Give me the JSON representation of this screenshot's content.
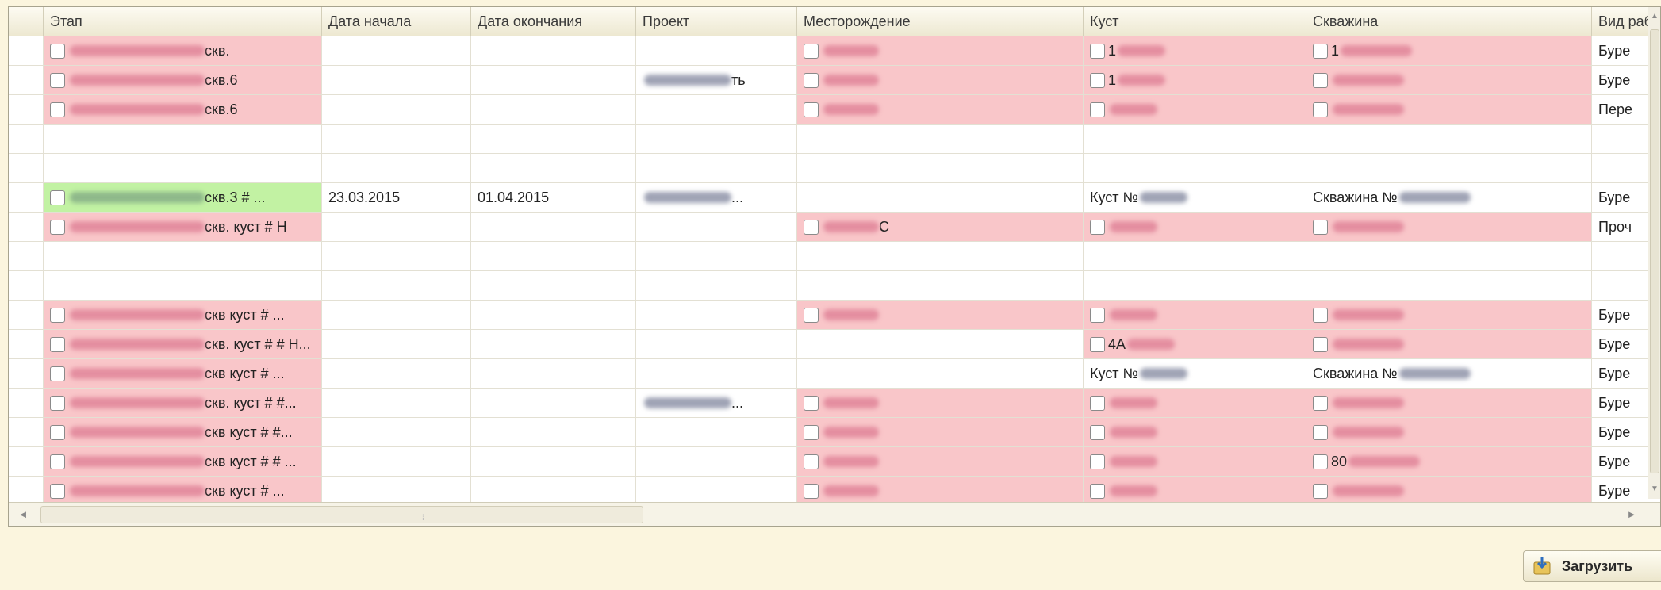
{
  "columns": [
    {
      "key": "stage",
      "label": "Этап"
    },
    {
      "key": "start",
      "label": "Дата начала"
    },
    {
      "key": "end",
      "label": "Дата окончания"
    },
    {
      "key": "project",
      "label": "Проект"
    },
    {
      "key": "field",
      "label": "Месторождение"
    },
    {
      "key": "pad",
      "label": "Куст"
    },
    {
      "key": "well",
      "label": "Скважина"
    },
    {
      "key": "work",
      "label": "Вид раб"
    }
  ],
  "rows": [
    {
      "stage": "скв.",
      "start": "",
      "end": "",
      "project": "",
      "field": "",
      "pad": "1",
      "well": "1",
      "work": "Буре"
    },
    {
      "stage": "скв.6",
      "start": "",
      "end": "",
      "project": "ть",
      "field": "",
      "pad": "1",
      "well": "",
      "work": "Буре"
    },
    {
      "stage": "скв.6",
      "start": "",
      "end": "",
      "project": "",
      "field": "",
      "pad": "",
      "well": "",
      "work": "Пере"
    },
    {
      "stage": "",
      "start": "",
      "end": "",
      "project": "",
      "field": "",
      "pad": "",
      "well": "",
      "work": ""
    },
    {
      "stage": "",
      "start": "",
      "end": "",
      "project": "",
      "field": "",
      "pad": "",
      "well": "",
      "work": ""
    },
    {
      "stage": "скв.3 # ...",
      "start": "23.03.2015",
      "end": "01.04.2015",
      "project": "...",
      "field": "",
      "pad": "Куст №",
      "well": "Скважина №",
      "work": "Буре"
    },
    {
      "stage": "скв. куст # Н",
      "start": "",
      "end": "",
      "project": "",
      "field": "С",
      "pad": "",
      "well": "",
      "work": "Проч"
    },
    {
      "stage": "",
      "start": "",
      "end": "",
      "project": "",
      "field": "",
      "pad": "",
      "well": "",
      "work": ""
    },
    {
      "stage": "",
      "start": "",
      "end": "",
      "project": "",
      "field": "",
      "pad": "",
      "well": "",
      "work": ""
    },
    {
      "stage": "скв куст # ...",
      "start": "",
      "end": "",
      "project": "",
      "field": "",
      "pad": "",
      "well": "",
      "work": "Буре"
    },
    {
      "stage": "скв. куст # # Н...",
      "start": "",
      "end": "",
      "project": "",
      "field": "",
      "pad": "4А",
      "well": "",
      "work": "Буре"
    },
    {
      "stage": "скв куст # ...",
      "start": "",
      "end": "",
      "project": "",
      "field": "",
      "pad": "Куст №",
      "well": "Скважина №",
      "work": "Буре"
    },
    {
      "stage": "скв. куст # #...",
      "start": "",
      "end": "",
      "project": "...",
      "field": "",
      "pad": "",
      "well": "",
      "work": "Буре"
    },
    {
      "stage": "скв куст # #...",
      "start": "",
      "end": "",
      "project": "",
      "field": "",
      "pad": "",
      "well": "",
      "work": "Буре"
    },
    {
      "stage": "скв куст # # ...",
      "start": "",
      "end": "",
      "project": "",
      "field": "",
      "pad": "",
      "well": "80",
      "work": "Буре"
    },
    {
      "stage": "скв куст # ...",
      "start": "",
      "end": "",
      "project": "",
      "field": "",
      "pad": "",
      "well": "",
      "work": "Буре"
    }
  ],
  "load_button": {
    "label": "Загрузить"
  },
  "colors": {
    "pink": "#f9c6c9",
    "green": "#c2f2a3",
    "header": "#ede8d1",
    "background": "#fbf5de"
  }
}
